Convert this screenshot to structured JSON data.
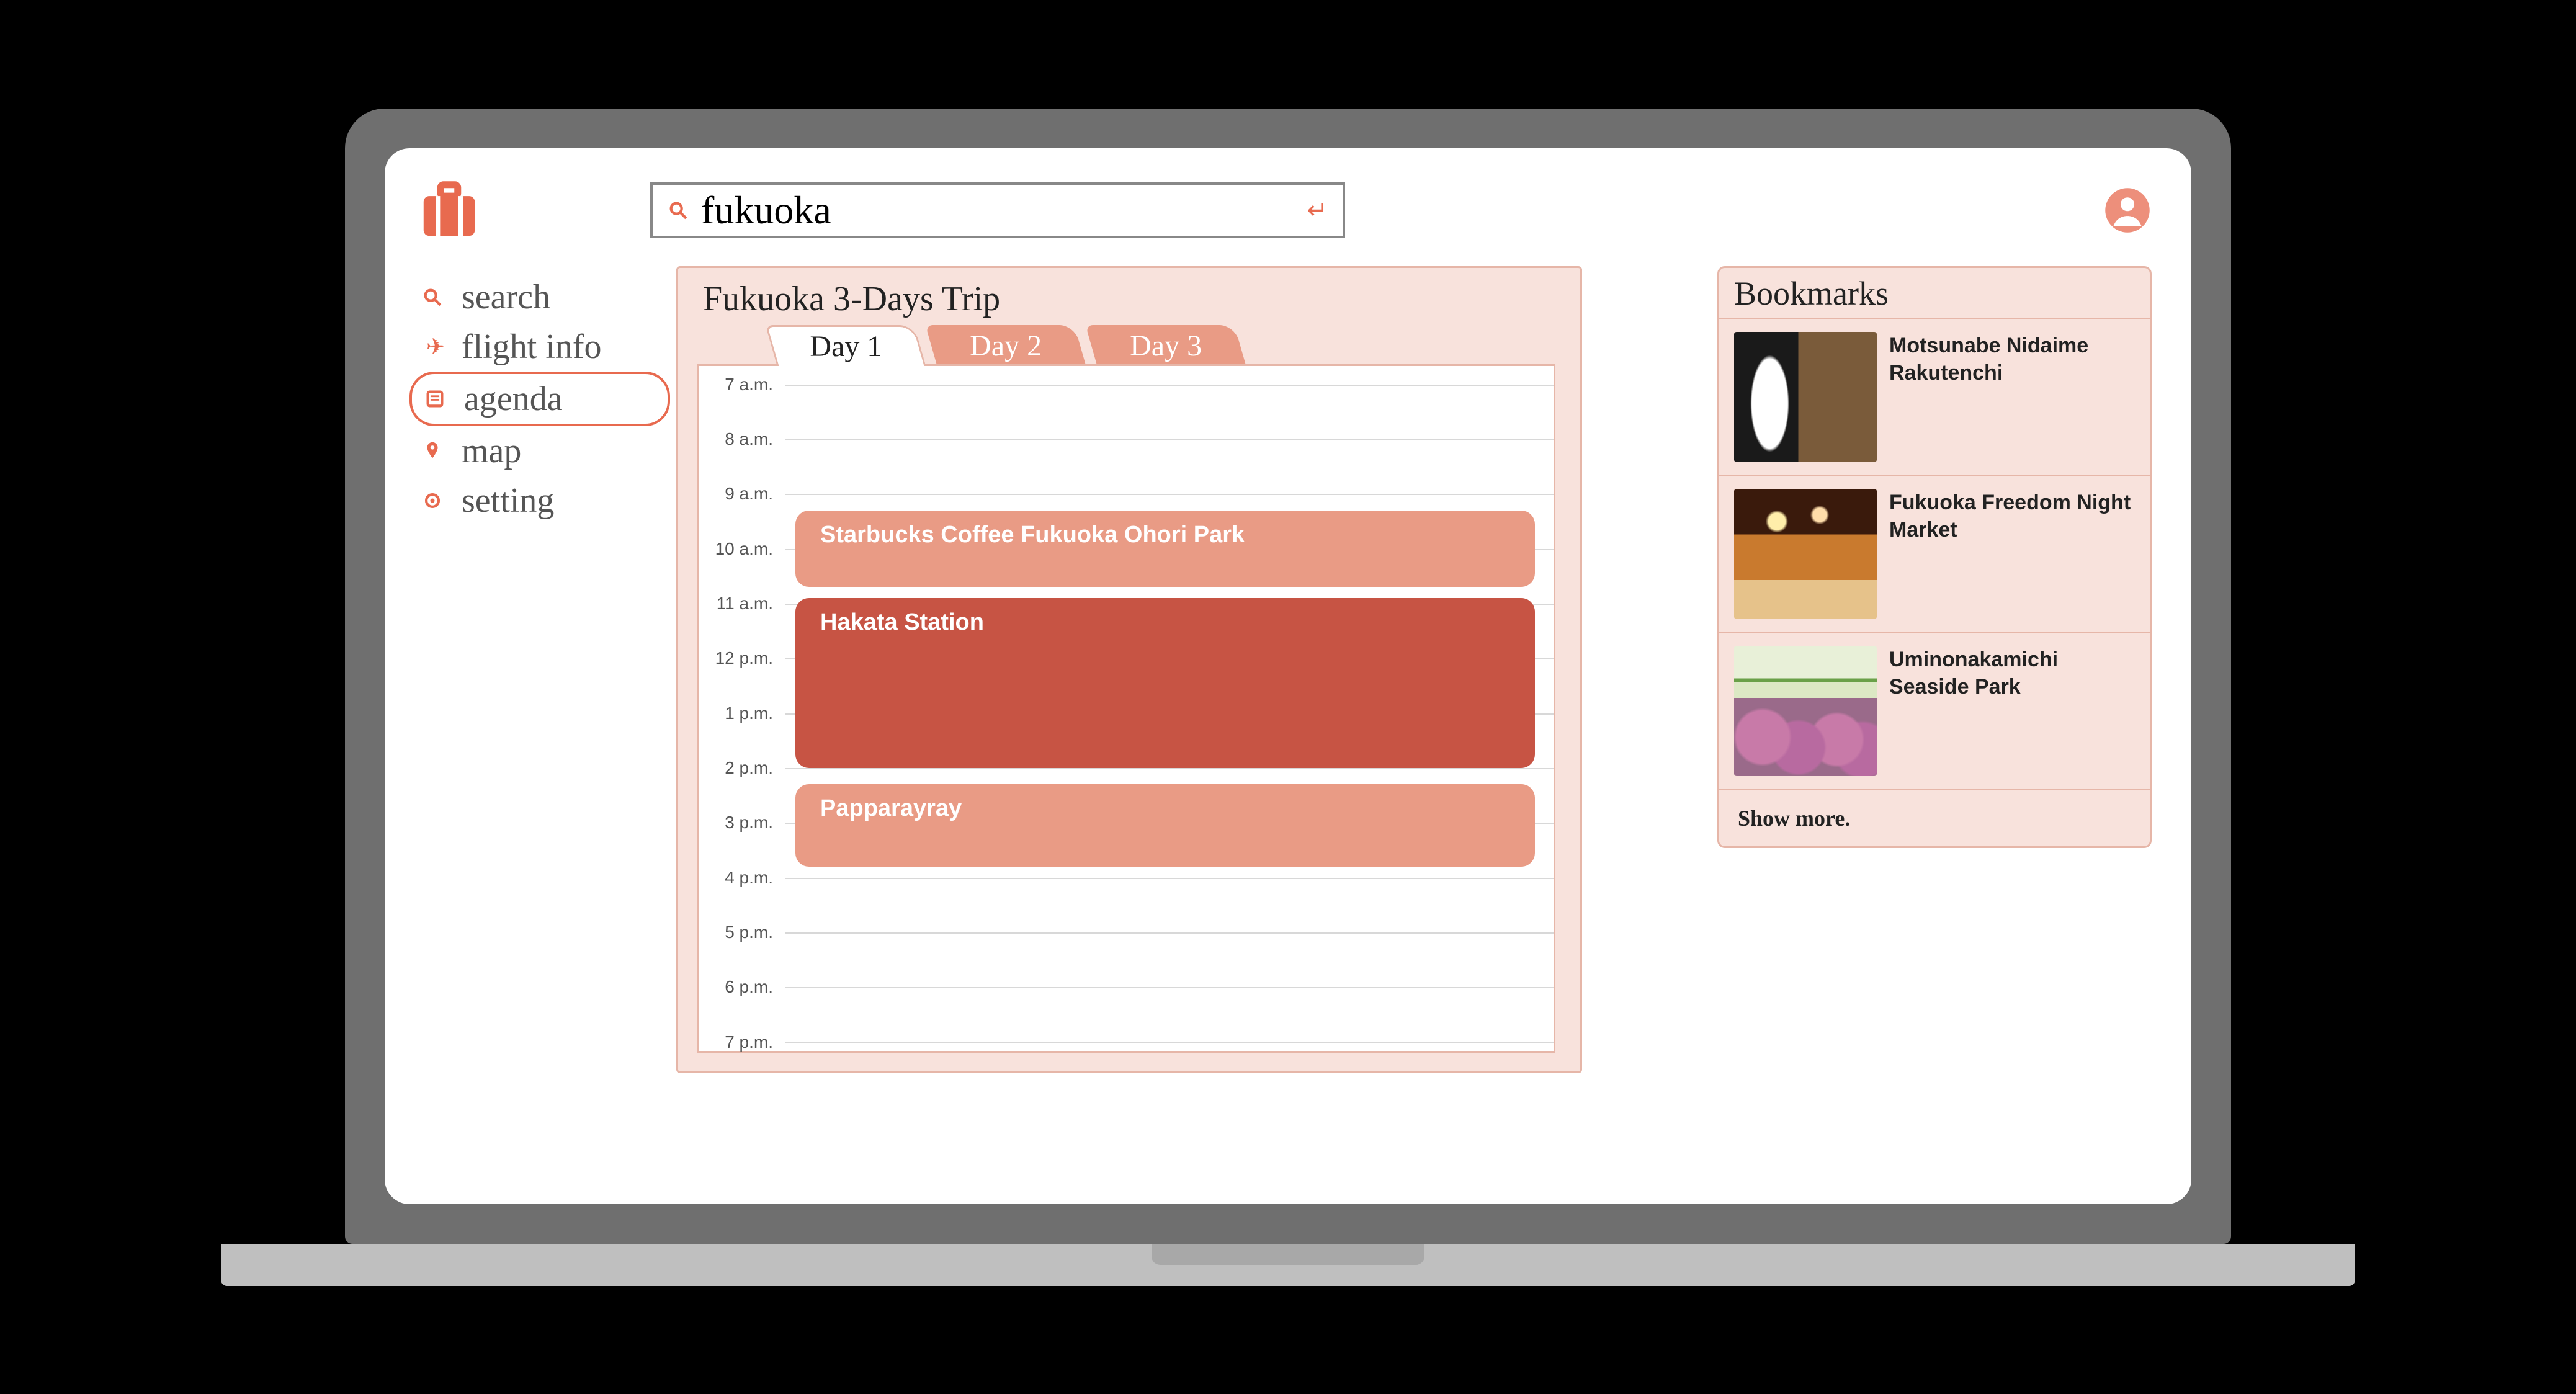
{
  "search": {
    "value": "fukuoka"
  },
  "sidebar": {
    "items": [
      {
        "label": "search",
        "active": false
      },
      {
        "label": "flight info",
        "active": false
      },
      {
        "label": "agenda",
        "active": true
      },
      {
        "label": "map",
        "active": false
      },
      {
        "label": "setting",
        "active": false
      }
    ]
  },
  "agenda": {
    "title": "Fukuoka 3-Days Trip",
    "tabs": [
      {
        "label": "Day 1",
        "active": true
      },
      {
        "label": "Day 2",
        "active": false
      },
      {
        "label": "Day 3",
        "active": false
      }
    ],
    "hours": [
      "7 a.m.",
      "8 a.m.",
      "9 a.m.",
      "10 a.m.",
      "11 a.m.",
      "12 p.m.",
      "1 p.m.",
      "2 p.m.",
      "3 p.m.",
      "4 p.m.",
      "5 p.m.",
      "6 p.m.",
      "7 p.m."
    ],
    "events": [
      {
        "title": "Starbucks Coffee Fukuoka Ohori Park",
        "start_idx": 2.3,
        "end_idx": 3.7,
        "tone": "light"
      },
      {
        "title": "Hakata Station",
        "start_idx": 3.9,
        "end_idx": 7.0,
        "tone": "dark"
      },
      {
        "title": "Papparayray",
        "start_idx": 7.3,
        "end_idx": 8.8,
        "tone": "light"
      }
    ]
  },
  "bookmarks": {
    "title": "Bookmarks",
    "items": [
      {
        "label": "Motsunabe Nidaime Rakutenchi"
      },
      {
        "label": "Fukuoka Freedom Night Market"
      },
      {
        "label": "Uminonakamichi Seaside Park"
      }
    ],
    "more": "Show more."
  }
}
